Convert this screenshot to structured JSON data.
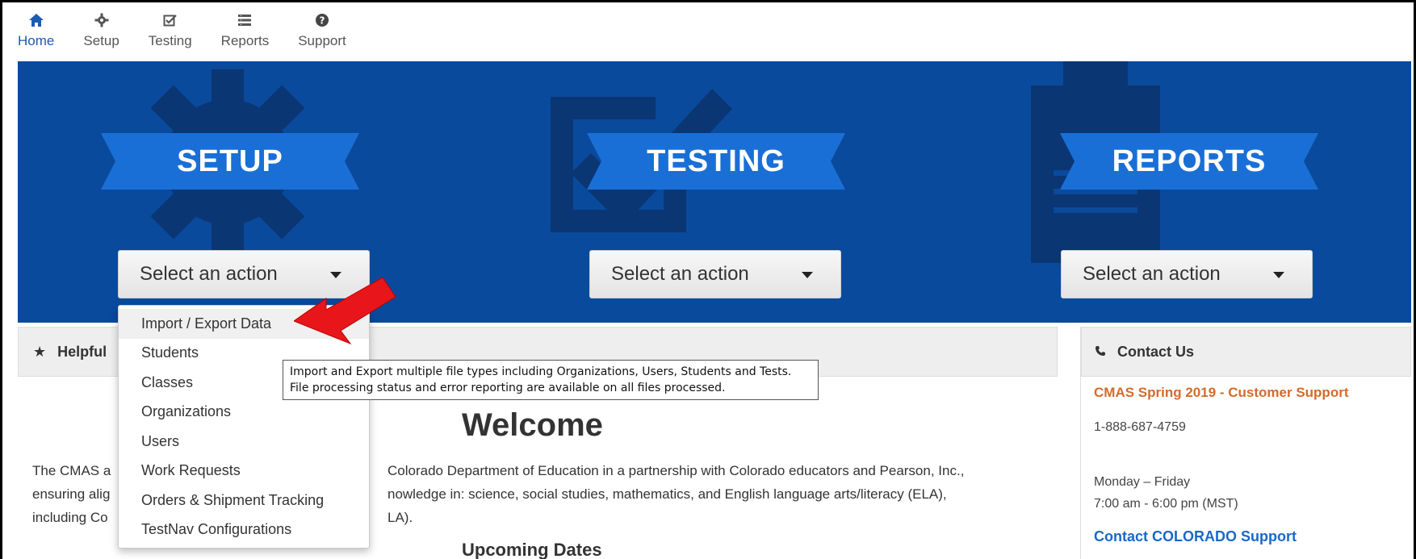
{
  "nav": [
    {
      "label": "Home",
      "icon": "home-icon",
      "active": true
    },
    {
      "label": "Setup",
      "icon": "gear-icon",
      "active": false
    },
    {
      "label": "Testing",
      "icon": "checkbox-icon",
      "active": false
    },
    {
      "label": "Reports",
      "icon": "list-icon",
      "active": false
    },
    {
      "label": "Support",
      "icon": "question-icon",
      "active": false
    }
  ],
  "banner": {
    "color": "#0a4a9c",
    "setup": {
      "title": "SETUP",
      "select_label": "Select an action"
    },
    "testing": {
      "title": "TESTING",
      "select_label": "Select an action"
    },
    "reports": {
      "title": "REPORTS",
      "select_label": "Select an action"
    }
  },
  "dropdown": {
    "items": [
      "Import / Export Data",
      "Students",
      "Classes",
      "Organizations",
      "Users",
      "Work Requests",
      "Orders & Shipment Tracking",
      "TestNav Configurations"
    ]
  },
  "tooltip": {
    "line1": "Import and Export multiple file types including Organizations, Users, Students and Tests.",
    "line2": "File processing status and error reporting are available on all files processed."
  },
  "helpful": {
    "title": "Helpful",
    "welcome": "Welcome",
    "intro_line1_a": "The CMAS a",
    "intro_line1_b": "Colorado Department of Education in a partnership with Colorado educators and Pearson, Inc.,",
    "intro_line2_a": "ensuring alig",
    "intro_line2_b": "nowledge in: science, social studies, mathematics, and English language arts/literacy (ELA),",
    "intro_line3_a": "including Co",
    "intro_line3_b": "LA).",
    "upcoming": "Upcoming Dates"
  },
  "contact": {
    "title": "Contact Us",
    "support_title": "CMAS Spring 2019 - Customer Support",
    "phone": "1-888-687-4759",
    "days": "Monday – Friday",
    "hours": "7:00 am - 6:00 pm (MST)",
    "link": "Contact COLORADO Support"
  },
  "colors": {
    "accent": "#1a5bb5",
    "orange": "#d36b2a",
    "link": "#1a68c7",
    "arrow": "#e8161b"
  }
}
